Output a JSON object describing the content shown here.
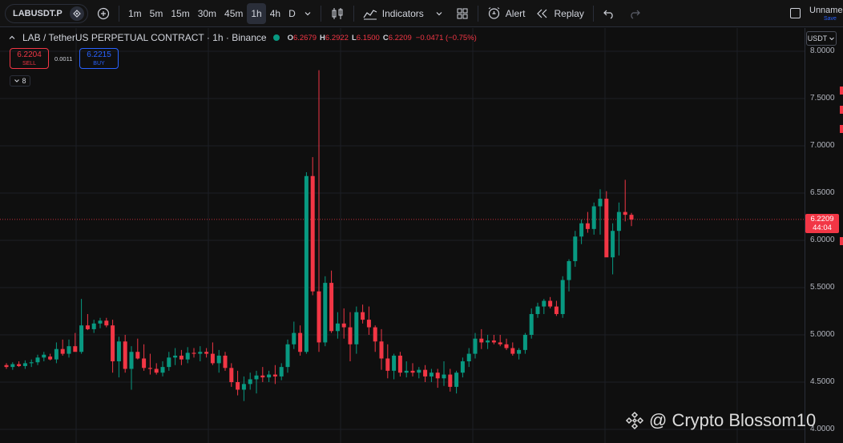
{
  "toolbar": {
    "symbol": "LABUSDT.P",
    "intervals": [
      "1m",
      "5m",
      "15m",
      "30m",
      "45m",
      "1h",
      "4h",
      "D"
    ],
    "active_interval": "1h",
    "indicators_label": "Indicators",
    "alert_label": "Alert",
    "replay_label": "Replay",
    "layout_name": "Unname",
    "save_label": "Save"
  },
  "legend": {
    "title": "LAB / TetherUS PERPETUAL CONTRACT · 1h · Binance",
    "o_label": "O",
    "o_value": "6.2679",
    "h_label": "H",
    "h_value": "6.2922",
    "l_label": "L",
    "l_value": "6.1500",
    "c_label": "C",
    "c_value": "6.2209",
    "change": "−0.0471 (−0.75%)"
  },
  "trade": {
    "sell_price": "6.2204",
    "sell_label": "SELL",
    "spread": "0.0011",
    "buy_price": "6.2215",
    "buy_label": "BUY",
    "collapsed_count": "8"
  },
  "price_axis": {
    "currency": "USDT",
    "current_price": "6.2209",
    "countdown": "44:04"
  },
  "watermark": "@ Crypto Blossom10",
  "colors": {
    "up": "#089981",
    "down": "#f23645",
    "background": "#0f0f0f",
    "accent": "#2962ff"
  },
  "chart_data": {
    "type": "candlestick",
    "ylim": [
      4.0,
      8.0
    ],
    "y_ticks": [
      "8.0000",
      "7.5000",
      "7.0000",
      "6.5000",
      "6.0000",
      "5.5000",
      "5.0000",
      "4.5000",
      "4.0000"
    ],
    "candles": [
      [
        4.68,
        4.7,
        4.64,
        4.66
      ],
      [
        4.66,
        4.71,
        4.63,
        4.69
      ],
      [
        4.69,
        4.72,
        4.66,
        4.67
      ],
      [
        4.67,
        4.73,
        4.64,
        4.7
      ],
      [
        4.7,
        4.74,
        4.66,
        4.71
      ],
      [
        4.71,
        4.79,
        4.68,
        4.76
      ],
      [
        4.76,
        4.82,
        4.72,
        4.79
      ],
      [
        4.77,
        4.8,
        4.73,
        4.74
      ],
      [
        4.74,
        4.92,
        4.7,
        4.85
      ],
      [
        4.85,
        4.95,
        4.78,
        4.8
      ],
      [
        4.8,
        4.95,
        4.76,
        4.88
      ],
      [
        4.88,
        5.02,
        4.84,
        4.82
      ],
      [
        4.82,
        5.38,
        4.8,
        5.1
      ],
      [
        5.1,
        5.22,
        5.05,
        5.06
      ],
      [
        5.06,
        5.16,
        5.02,
        5.12
      ],
      [
        5.12,
        5.18,
        5.07,
        5.15
      ],
      [
        5.15,
        5.18,
        5.08,
        5.1
      ],
      [
        5.1,
        5.16,
        4.6,
        4.72
      ],
      [
        4.72,
        4.98,
        4.55,
        4.93
      ],
      [
        4.93,
        5.0,
        4.6,
        4.64
      ],
      [
        4.64,
        4.88,
        4.42,
        4.82
      ],
      [
        4.82,
        4.96,
        4.74,
        4.75
      ],
      [
        4.75,
        4.9,
        4.62,
        4.65
      ],
      [
        4.65,
        4.8,
        4.58,
        4.64
      ],
      [
        4.64,
        4.7,
        4.58,
        4.6
      ],
      [
        4.6,
        4.72,
        4.56,
        4.66
      ],
      [
        4.66,
        4.82,
        4.62,
        4.76
      ],
      [
        4.76,
        4.86,
        4.68,
        4.78
      ],
      [
        4.78,
        4.84,
        4.68,
        4.74
      ],
      [
        4.74,
        4.87,
        4.7,
        4.81
      ],
      [
        4.81,
        4.86,
        4.76,
        4.8
      ],
      [
        4.8,
        4.88,
        4.72,
        4.82
      ],
      [
        4.82,
        4.86,
        4.76,
        4.8
      ],
      [
        4.8,
        4.92,
        4.68,
        4.7
      ],
      [
        4.7,
        4.84,
        4.6,
        4.78
      ],
      [
        4.78,
        4.82,
        4.62,
        4.65
      ],
      [
        4.65,
        4.7,
        4.45,
        4.5
      ],
      [
        4.5,
        4.62,
        4.36,
        4.42
      ],
      [
        4.42,
        4.56,
        4.3,
        4.48
      ],
      [
        4.48,
        4.6,
        4.42,
        4.53
      ],
      [
        4.53,
        4.62,
        4.38,
        4.57
      ],
      [
        4.57,
        4.66,
        4.5,
        4.55
      ],
      [
        4.55,
        4.62,
        4.5,
        4.58
      ],
      [
        4.58,
        4.68,
        4.48,
        4.56
      ],
      [
        4.56,
        4.7,
        4.52,
        4.66
      ],
      [
        4.66,
        4.95,
        4.6,
        4.9
      ],
      [
        4.9,
        5.14,
        4.85,
        5.02
      ],
      [
        5.02,
        5.1,
        4.78,
        4.82
      ],
      [
        4.82,
        6.72,
        4.8,
        6.68
      ],
      [
        6.68,
        6.88,
        5.42,
        5.46
      ],
      [
        5.46,
        7.8,
        4.82,
        4.92
      ],
      [
        4.92,
        5.62,
        4.88,
        5.55
      ],
      [
        5.55,
        5.68,
        5.02,
        5.04
      ],
      [
        5.04,
        5.24,
        4.96,
        5.12
      ],
      [
        5.12,
        5.28,
        4.96,
        5.08
      ],
      [
        5.08,
        5.24,
        4.72,
        4.9
      ],
      [
        4.9,
        5.3,
        4.8,
        5.24
      ],
      [
        5.24,
        5.32,
        5.12,
        5.16
      ],
      [
        5.16,
        5.3,
        5.0,
        5.08
      ],
      [
        5.08,
        5.1,
        4.82,
        4.93
      ],
      [
        4.93,
        5.06,
        4.63,
        4.75
      ],
      [
        4.75,
        4.9,
        4.54,
        4.62
      ],
      [
        4.62,
        4.8,
        4.53,
        4.78
      ],
      [
        4.78,
        4.82,
        4.56,
        4.6
      ],
      [
        4.6,
        4.72,
        4.55,
        4.62
      ],
      [
        4.62,
        4.7,
        4.56,
        4.6
      ],
      [
        4.6,
        4.66,
        4.54,
        4.63
      ],
      [
        4.63,
        4.68,
        4.5,
        4.56
      ],
      [
        4.56,
        4.64,
        4.5,
        4.6
      ],
      [
        4.6,
        4.64,
        4.44,
        4.54
      ],
      [
        4.54,
        4.72,
        4.46,
        4.58
      ],
      [
        4.58,
        4.64,
        4.4,
        4.45
      ],
      [
        4.45,
        4.62,
        4.38,
        4.6
      ],
      [
        4.6,
        4.76,
        4.55,
        4.72
      ],
      [
        4.72,
        4.86,
        4.66,
        4.8
      ],
      [
        4.8,
        5.02,
        4.75,
        4.96
      ],
      [
        4.96,
        5.06,
        4.85,
        4.92
      ],
      [
        4.92,
        5.0,
        4.85,
        4.94
      ],
      [
        4.94,
        5.0,
        4.9,
        4.92
      ],
      [
        4.92,
        5.0,
        4.88,
        4.9
      ],
      [
        4.9,
        4.96,
        4.84,
        4.86
      ],
      [
        4.86,
        4.92,
        4.78,
        4.8
      ],
      [
        4.8,
        4.86,
        4.74,
        4.84
      ],
      [
        4.84,
        5.02,
        4.8,
        5.0
      ],
      [
        5.0,
        5.28,
        4.96,
        5.22
      ],
      [
        5.22,
        5.34,
        5.18,
        5.3
      ],
      [
        5.3,
        5.38,
        5.22,
        5.36
      ],
      [
        5.36,
        5.4,
        5.28,
        5.3
      ],
      [
        5.3,
        5.36,
        5.2,
        5.22
      ],
      [
        5.22,
        5.62,
        5.18,
        5.58
      ],
      [
        5.58,
        5.8,
        5.46,
        5.78
      ],
      [
        5.78,
        6.1,
        5.72,
        6.04
      ],
      [
        6.04,
        6.22,
        5.96,
        6.18
      ],
      [
        6.18,
        6.3,
        6.08,
        6.12
      ],
      [
        6.12,
        6.4,
        6.06,
        6.36
      ],
      [
        6.36,
        6.54,
        6.06,
        6.44
      ],
      [
        6.44,
        6.52,
        5.84,
        5.82
      ],
      [
        5.82,
        6.18,
        5.64,
        6.1
      ],
      [
        6.1,
        6.4,
        5.84,
        6.3
      ],
      [
        6.3,
        6.64,
        6.2,
        6.27
      ],
      [
        6.27,
        6.29,
        6.15,
        6.22
      ]
    ]
  }
}
